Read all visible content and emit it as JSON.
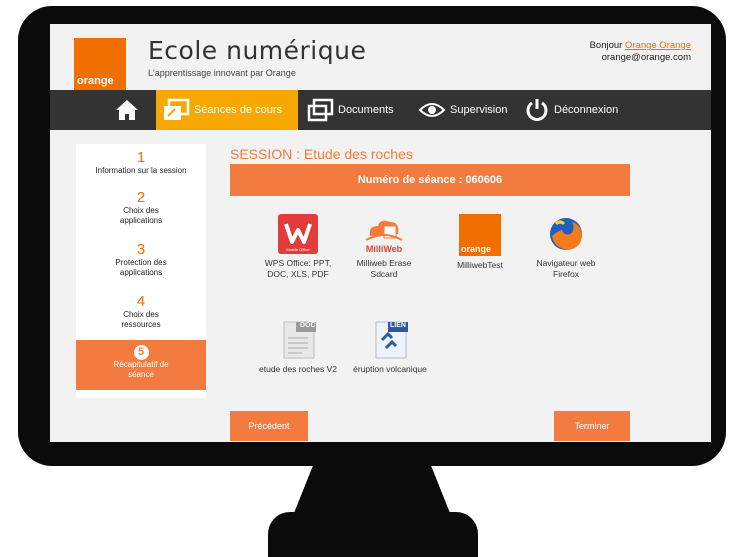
{
  "header": {
    "brand": "orange",
    "title": "Ecole numérique",
    "subtitle": "L'apprentissage innovant par Orange",
    "greeting": "Bonjour",
    "user_name": "Orange Orange",
    "email": "orange@orange.com"
  },
  "nav": {
    "seances": "Séances de cours",
    "documents": "Documents",
    "supervision": "Supervision",
    "deconnexion": "Déconnexion"
  },
  "steps": [
    {
      "num": "1",
      "label": "Information sur la session"
    },
    {
      "num": "2",
      "label": "Choix des applications"
    },
    {
      "num": "3",
      "label": "Protection des applications"
    },
    {
      "num": "4",
      "label": "Choix des ressources"
    },
    {
      "num": "5",
      "label": "Récapitulatif de séance"
    }
  ],
  "main": {
    "session_title": "SESSION : Etude des roches",
    "seance_number": "Numéro de séance : 060606",
    "apps": [
      {
        "label": "WPS Office: PPT, DOC, XLS, PDF",
        "icon": "wps-office-icon",
        "icon_text": "Mobile Office"
      },
      {
        "label": "Milliweb Erase Sdcard",
        "icon": "milliweb-icon",
        "icon_text": "MilliWeb"
      },
      {
        "label": "MilliwebTest",
        "icon": "orange-logo-icon",
        "icon_text": "orange"
      },
      {
        "label": "Navigateur web Firefox",
        "icon": "firefox-icon"
      }
    ],
    "resources": [
      {
        "label": "etude des roches V2",
        "icon": "doc-file-icon",
        "icon_text": "DOC"
      },
      {
        "label": "éruption volcanique",
        "icon": "link-file-icon",
        "icon_text": "LIEN"
      }
    ],
    "prev_button": "Précédent",
    "finish_button": "Terminer"
  },
  "colors": {
    "orange": "#f16e00",
    "accent": "#f37b3f",
    "nav_active": "#f7a800",
    "nav_bg": "#333333"
  }
}
